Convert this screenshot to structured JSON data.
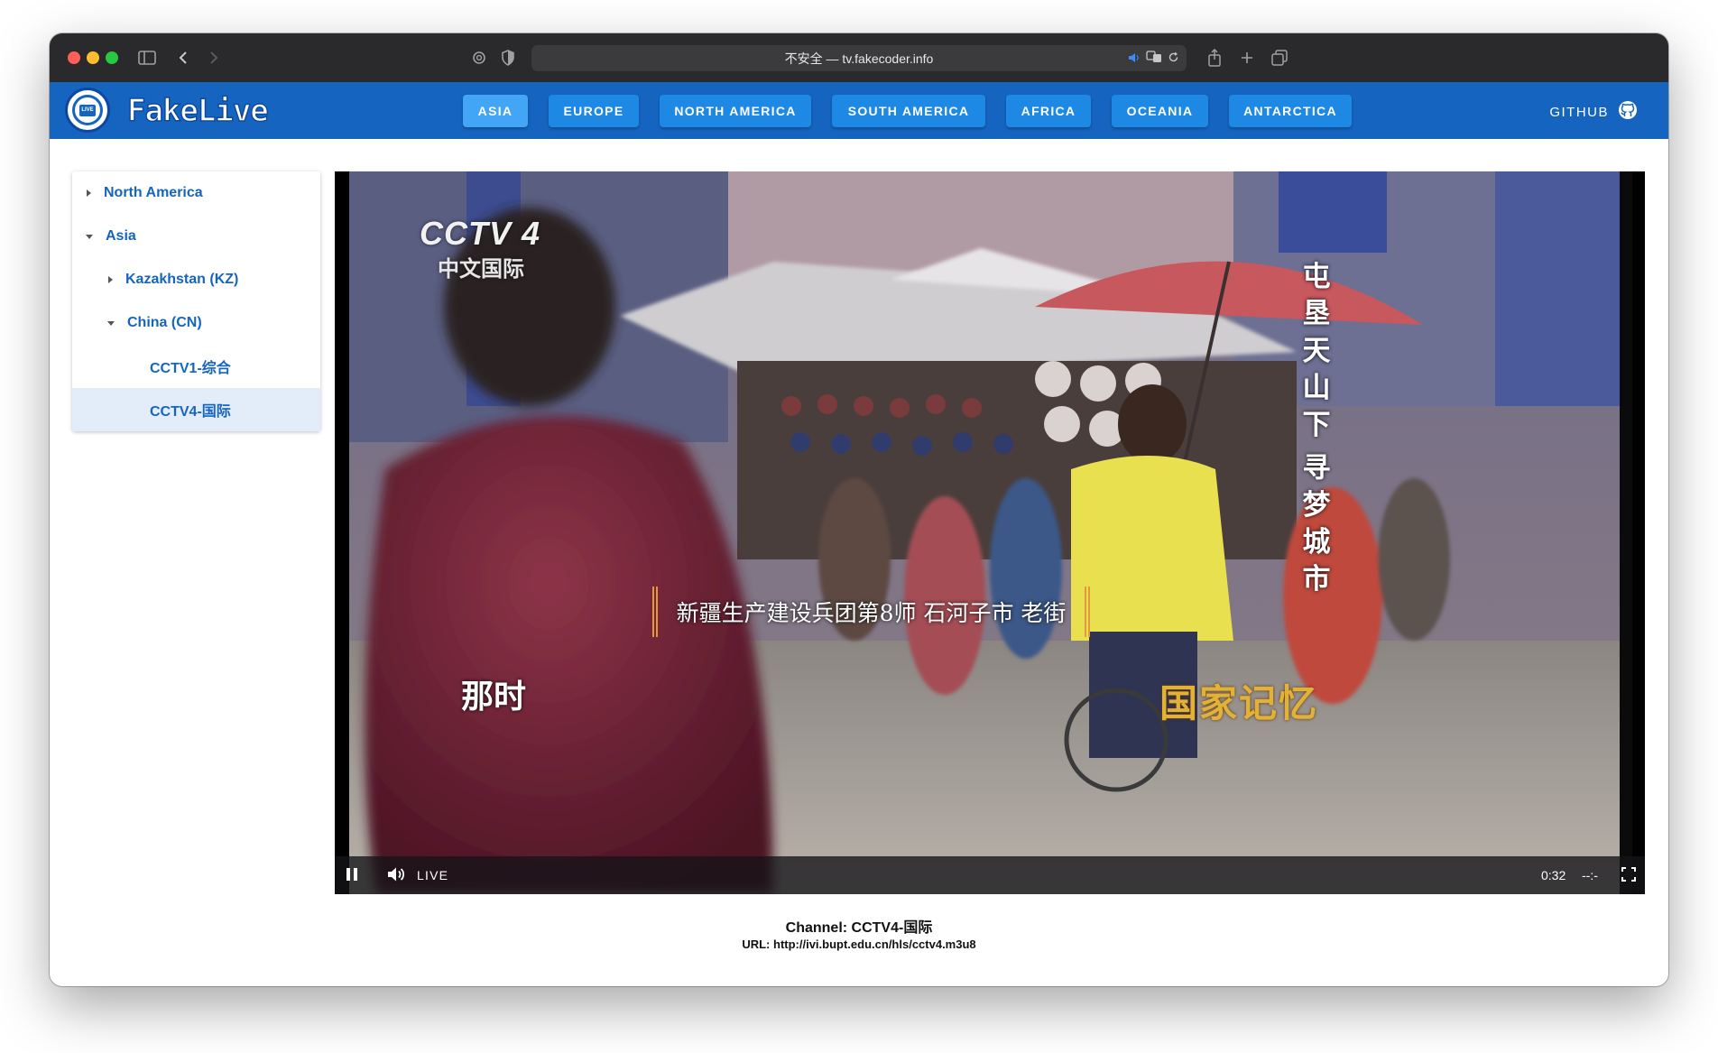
{
  "browser": {
    "url_text": "不安全 — tv.fakecoder.info"
  },
  "app": {
    "brand": "FakeLive",
    "logo_badge": "LIVE",
    "nav": [
      {
        "label": "ASIA",
        "active": true
      },
      {
        "label": "EUROPE",
        "active": false
      },
      {
        "label": "NORTH AMERICA",
        "active": false
      },
      {
        "label": "SOUTH AMERICA",
        "active": false
      },
      {
        "label": "AFRICA",
        "active": false
      },
      {
        "label": "OCEANIA",
        "active": false
      },
      {
        "label": "ANTARCTICA",
        "active": false
      }
    ],
    "github_label": "GITHUB"
  },
  "sidebar": {
    "items": [
      {
        "label": "North America",
        "expanded": false
      },
      {
        "label": "Asia",
        "expanded": true
      },
      {
        "label": "Kazakhstan (KZ)",
        "expanded": false
      },
      {
        "label": "China (CN)",
        "expanded": true
      },
      {
        "label": "CCTV1-综合",
        "selected": false
      },
      {
        "label": "CCTV4-国际",
        "selected": true
      }
    ]
  },
  "player": {
    "overlay": {
      "channel_logo": "CCTV 4",
      "channel_logo_sub": "中文国际",
      "vertical_title_1": "屯垦天山下",
      "vertical_title_2": "寻梦城市",
      "banner": "新疆生产建设兵团第8师 石河子市 老街",
      "subtitle": "那时",
      "program_logo": "国家记忆"
    },
    "controls": {
      "live_label": "LIVE",
      "elapsed": "0:32",
      "remaining": "--:-"
    }
  },
  "info": {
    "channel_line": "Channel: CCTV4-国际",
    "url_line": "URL: http://ivi.bupt.edu.cn/hls/cctv4.m3u8"
  },
  "colors": {
    "appbar": "#1565c0",
    "nav_button": "#1e88e5",
    "nav_active": "#42a5f5",
    "link": "#1565c0",
    "selected_row": "#e3edf9"
  }
}
